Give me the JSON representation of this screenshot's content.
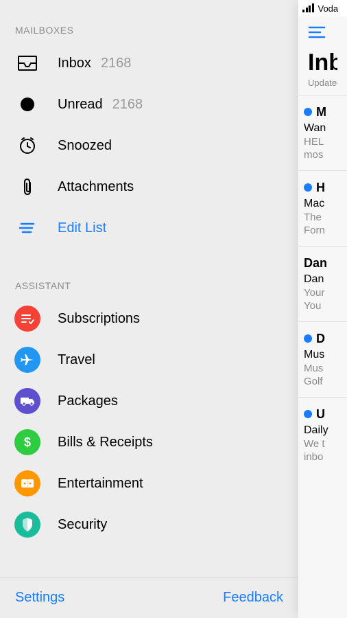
{
  "status": {
    "carrier": "Voda"
  },
  "sidebar": {
    "sections": {
      "mailboxes": {
        "header": "MAILBOXES",
        "items": [
          {
            "label": "Inbox",
            "count": "2168",
            "icon": "inbox-icon"
          },
          {
            "label": "Unread",
            "count": "2168",
            "icon": "unread-icon"
          },
          {
            "label": "Snoozed",
            "count": "",
            "icon": "clock-icon"
          },
          {
            "label": "Attachments",
            "count": "",
            "icon": "paperclip-icon"
          }
        ],
        "edit_label": "Edit List"
      },
      "assistant": {
        "header": "ASSISTANT",
        "items": [
          {
            "label": "Subscriptions",
            "icon": "subscriptions-icon",
            "color": "red"
          },
          {
            "label": "Travel",
            "icon": "travel-icon",
            "color": "blue"
          },
          {
            "label": "Packages",
            "icon": "packages-icon",
            "color": "purple"
          },
          {
            "label": "Bills & Receipts",
            "icon": "bills-icon",
            "color": "green"
          },
          {
            "label": "Entertainment",
            "icon": "entertainment-icon",
            "color": "orange"
          },
          {
            "label": "Security",
            "icon": "security-icon",
            "color": "teal"
          }
        ]
      }
    },
    "footer": {
      "settings": "Settings",
      "feedback": "Feedback"
    }
  },
  "main": {
    "title": "Inbox",
    "subtitle": "Updated",
    "messages": [
      {
        "unread": true,
        "sender": "M",
        "subject": "Wan",
        "line1": "HEL",
        "line2": "mos"
      },
      {
        "unread": true,
        "sender": "H",
        "subject": "Mac",
        "line1": "The",
        "line2": "Forn"
      },
      {
        "unread": false,
        "sender": "Dan",
        "subject": "Dan",
        "line1": "Your",
        "line2": "You"
      },
      {
        "unread": true,
        "sender": "D",
        "subject": "Mus",
        "line1": "Mus",
        "line2": "Golf"
      },
      {
        "unread": true,
        "sender": "U",
        "subject": "Daily",
        "line1": "We t",
        "line2": "inbo"
      }
    ]
  }
}
